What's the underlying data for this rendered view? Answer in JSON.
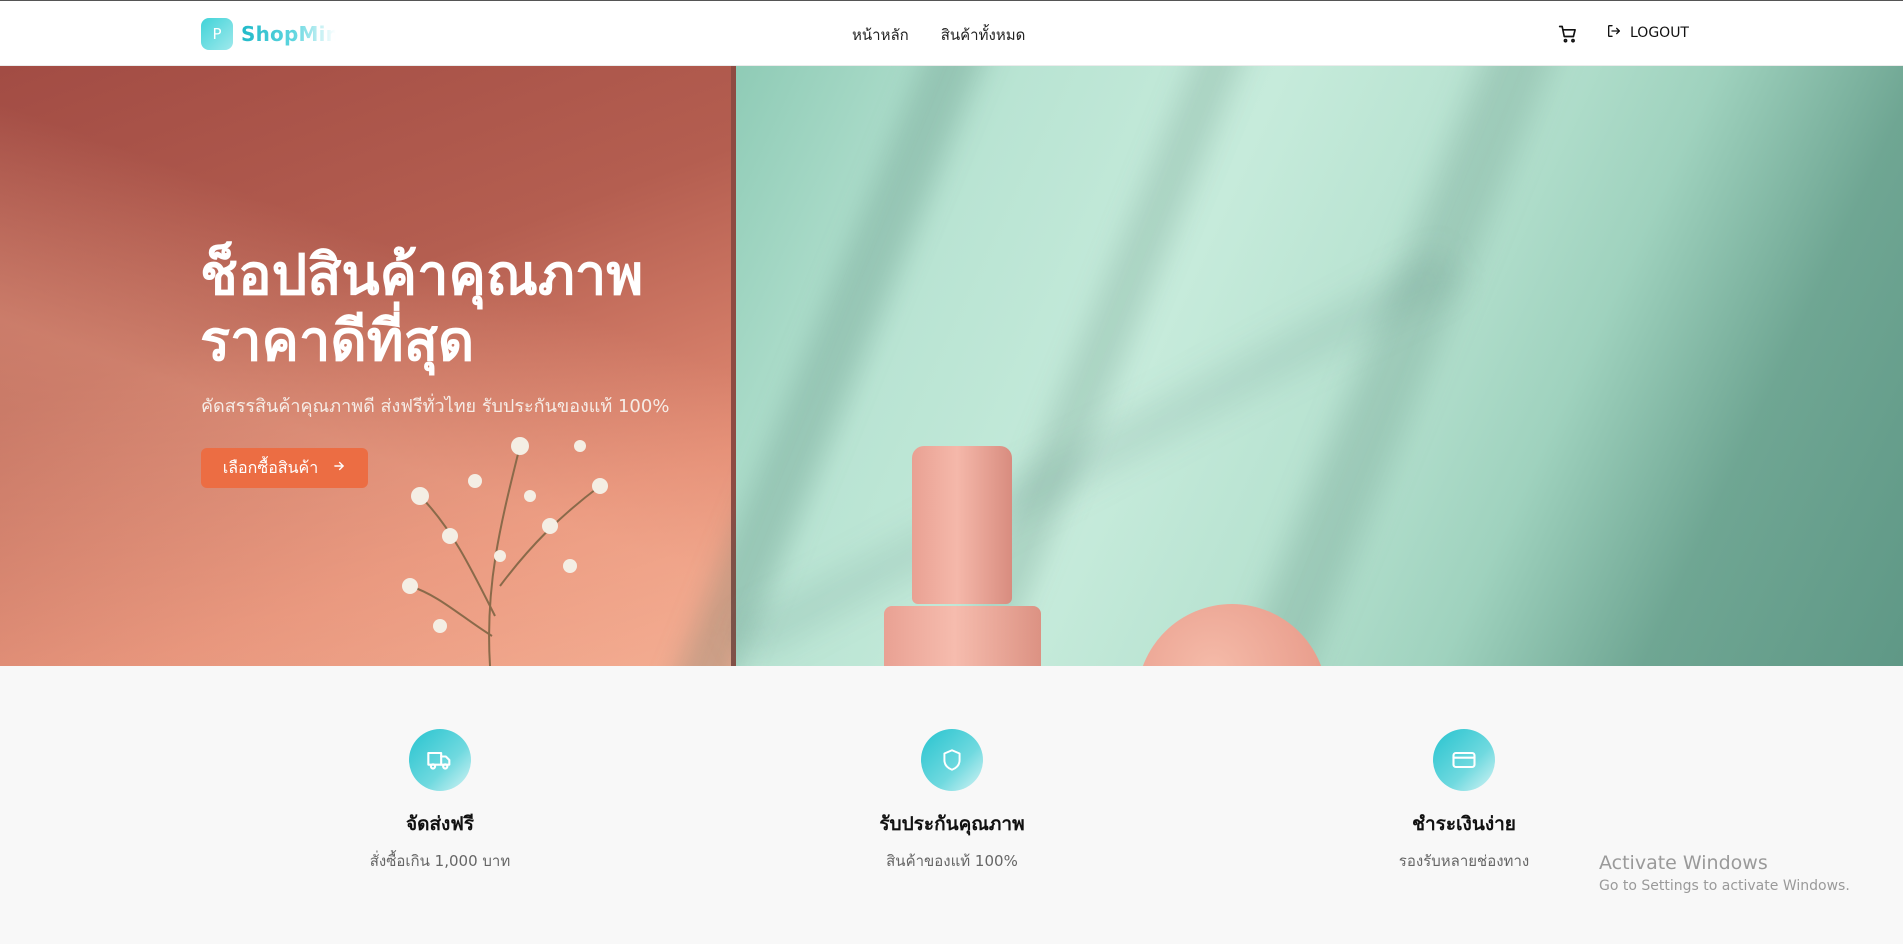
{
  "header": {
    "logo_letter": "P",
    "logo_text": "ShopMini",
    "nav": [
      {
        "label": "หน้าหลัก"
      },
      {
        "label": "สินค้าทั้งหมด"
      }
    ],
    "cart_icon": "cart-icon",
    "logout_icon": "logout-icon",
    "logout_label": "LOGOUT"
  },
  "hero": {
    "title_line1": "ช็อปสินค้าคุณภาพ",
    "title_line2": "ราคาดีที่สุด",
    "subtitle": "คัดสรรสินค้าคุณภาพดี ส่งฟรีทั่วไทย รับประกันของแท้ 100%",
    "cta_label": "เลือกซื้อสินค้า",
    "cta_icon": "arrow-right-icon"
  },
  "features": [
    {
      "icon": "truck-icon",
      "title": "จัดส่งฟรี",
      "desc": "สั่งซื้อเกิน 1,000 บาท"
    },
    {
      "icon": "shield-icon",
      "title": "รับประกันคุณภาพ",
      "desc": "สินค้าของแท้ 100%"
    },
    {
      "icon": "credit-card-icon",
      "title": "ชำระเงินง่าย",
      "desc": "รองรับหลายช่องทาง"
    }
  ],
  "watermark": {
    "line1": "Activate Windows",
    "line2": "Go to Settings to activate Windows."
  },
  "colors": {
    "accent": "#ec6d43",
    "brand": "#26c3cf"
  }
}
